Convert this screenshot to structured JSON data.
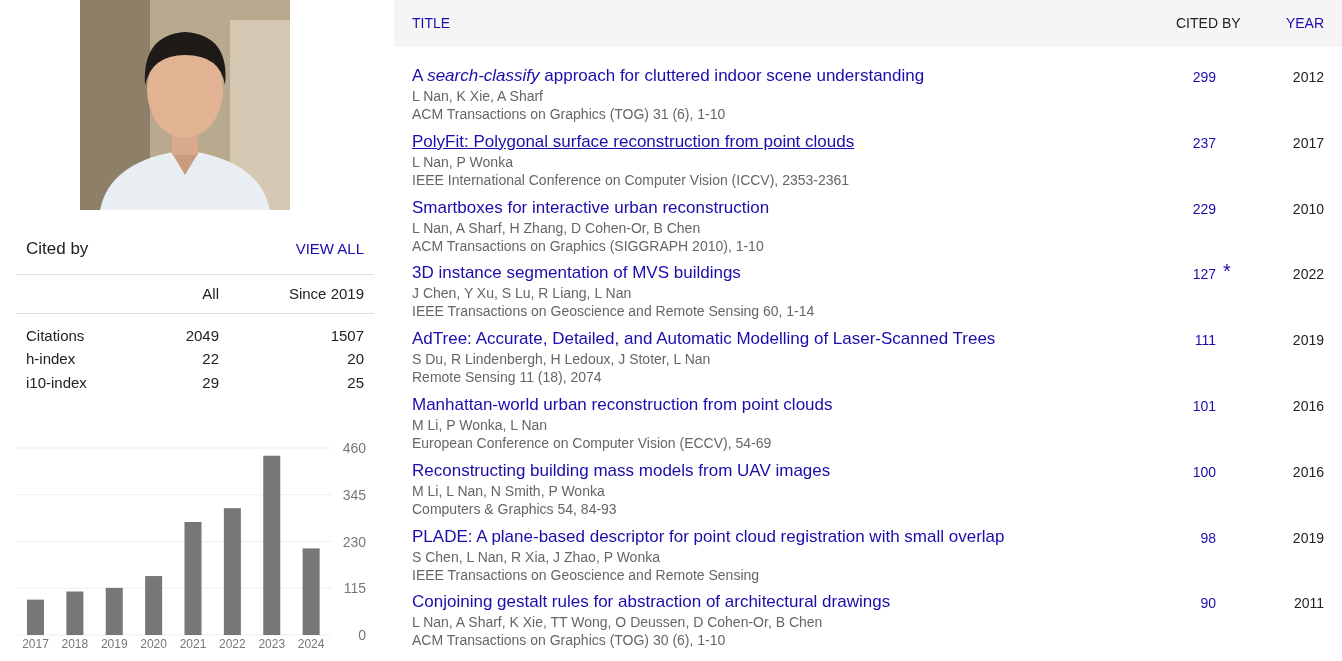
{
  "cited_by": {
    "title": "Cited by",
    "view_all": "VIEW ALL",
    "columns": [
      "All",
      "Since 2019"
    ],
    "rows": [
      {
        "label": "Citations",
        "all": "2049",
        "since": "1507"
      },
      {
        "label": "h-index",
        "all": "22",
        "since": "20"
      },
      {
        "label": "i10-index",
        "all": "29",
        "since": "25"
      }
    ],
    "chart_data": {
      "type": "bar",
      "categories": [
        "2017",
        "2018",
        "2019",
        "2020",
        "2021",
        "2022",
        "2023",
        "2024"
      ],
      "values": [
        87,
        107,
        116,
        145,
        278,
        312,
        441,
        213
      ],
      "ylim": [
        0,
        460
      ],
      "grid": true,
      "yticks": [
        0,
        115,
        230,
        345,
        460
      ]
    }
  },
  "table": {
    "columns": [
      "TITLE",
      "CITED BY",
      "YEAR"
    ],
    "rows": [
      {
        "title": "A *search-classify* approach for cluttered indoor scene understanding",
        "hovered": false,
        "authors": "L Nan, K Xie, A Sharf",
        "venue": "ACM Transactions on Graphics (TOG) 31 (6), 1-10",
        "cited": "299",
        "year": "2012"
      },
      {
        "title": "PolyFit: Polygonal surface reconstruction from point clouds",
        "hovered": true,
        "authors": "L Nan, P Wonka",
        "venue": "IEEE International Conference on Computer Vision (ICCV), 2353-2361",
        "cited": "237",
        "year": "2017"
      },
      {
        "title": "Smartboxes for interactive urban reconstruction",
        "hovered": false,
        "authors": "L Nan, A Sharf, H Zhang, D Cohen-Or, B Chen",
        "venue": "ACM Transactions on Graphics (SIGGRAPH 2010), 1-10",
        "cited": "229",
        "year": "2010"
      },
      {
        "title": "3D instance segmentation of MVS buildings",
        "hovered": false,
        "authors": "J Chen, Y Xu, S Lu, R Liang, L Nan",
        "venue": "IEEE Transactions on Geoscience and Remote Sensing 60, 1-14",
        "cited": "127",
        "note": "*",
        "year": "2022"
      },
      {
        "title": "AdTree: Accurate, Detailed, and Automatic Modelling of Laser-Scanned Trees",
        "hovered": false,
        "authors": "S Du, R Lindenbergh, H Ledoux, J Stoter, L Nan",
        "venue": "Remote Sensing 11 (18), 2074",
        "cited": "111",
        "year": "2019"
      },
      {
        "title": "Manhattan-world urban reconstruction from point clouds",
        "hovered": false,
        "authors": "M Li, P Wonka, L Nan",
        "venue": "European Conference on Computer Vision (ECCV), 54-69",
        "cited": "101",
        "year": "2016"
      },
      {
        "title": "Reconstructing building mass models from UAV images",
        "hovered": false,
        "authors": "M Li, L Nan, N Smith, P Wonka",
        "venue": "Computers & Graphics 54, 84-93",
        "cited": "100",
        "year": "2016"
      },
      {
        "title": "PLADE: A plane-based descriptor for point cloud registration with small overlap",
        "hovered": false,
        "authors": "S Chen, L Nan, R Xia, J Zhao, P Wonka",
        "venue": "IEEE Transactions on Geoscience and Remote Sensing",
        "cited": "98",
        "year": "2019"
      },
      {
        "title": "Conjoining gestalt rules for abstraction of architectural drawings",
        "hovered": false,
        "authors": "L Nan, A Sharf, K Xie, TT Wong, O Deussen, D Cohen-Or, B Chen",
        "venue": "ACM Transactions on Graphics (TOG) 30 (6), 1-10",
        "cited": "90",
        "year": "2011"
      }
    ]
  }
}
